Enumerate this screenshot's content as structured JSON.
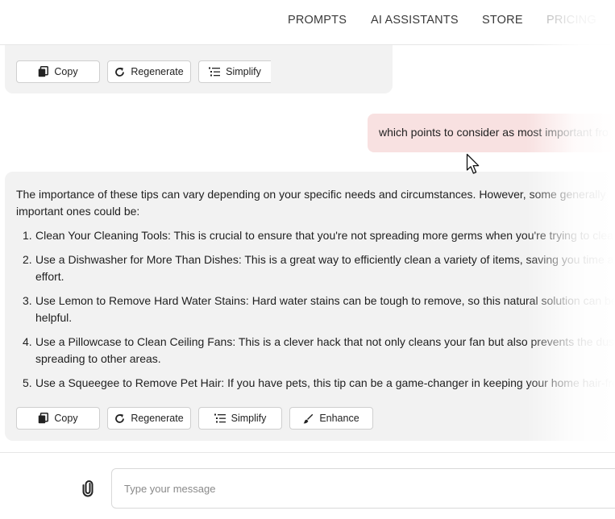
{
  "nav": {
    "items": [
      {
        "label": "PROMPTS"
      },
      {
        "label": "AI ASSISTANTS"
      },
      {
        "label": "STORE"
      },
      {
        "label": "PRICING"
      }
    ]
  },
  "top_card": {
    "actions": {
      "copy_label": "Copy",
      "regenerate_label": "Regenerate",
      "simplify_label": "Simplify"
    }
  },
  "user_message": {
    "text": "which points to consider as most important fro"
  },
  "answer": {
    "intro": "The importance of these tips can vary depending on your specific needs and circumstances. However, some generally important ones could be:",
    "items": [
      {
        "num": "1.",
        "text": "Clean Your Cleaning Tools: This is crucial to ensure that you're not spreading more germs when you're trying to clea"
      },
      {
        "num": "2.",
        "text": "Use a Dishwasher for More Than Dishes: This is a great way to efficiently clean a variety of items, saving you time and effort."
      },
      {
        "num": "3.",
        "text": "Use Lemon to Remove Hard Water Stains: Hard water stains can be tough to remove, so this natural solution can be helpful."
      },
      {
        "num": "4.",
        "text": "Use a Pillowcase to Clean Ceiling Fans: This is a clever hack that not only cleans your fan but also prevents the dust f spreading to other areas."
      },
      {
        "num": "5.",
        "text": "Use a Squeegee to Remove Pet Hair: If you have pets, this tip can be a game-changer in keeping your home hair-free"
      }
    ],
    "actions": {
      "copy_label": "Copy",
      "regenerate_label": "Regenerate",
      "simplify_label": "Simplify",
      "enhance_label": "Enhance"
    }
  },
  "composer": {
    "placeholder": "Type your message"
  },
  "colors": {
    "user_bubble": "#f8e1e1",
    "card_background": "#f2f2f2",
    "nav_text": "#3a3a3a"
  },
  "icons": {
    "copy": "copy-icon",
    "regenerate": "regenerate-icon",
    "simplify": "list-icon",
    "enhance": "brush-icon",
    "attach": "paperclip-icon",
    "cursor": "mouse-pointer-icon"
  }
}
